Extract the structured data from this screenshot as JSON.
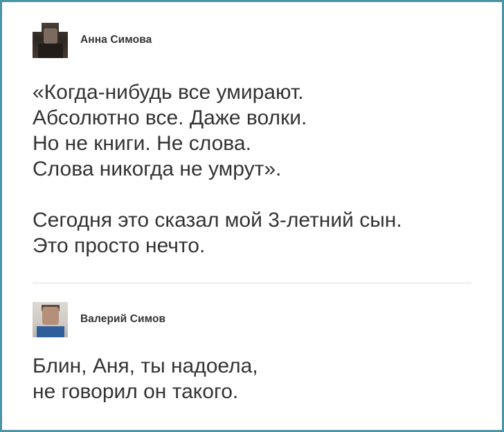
{
  "posts": [
    {
      "author": "Анна Симова",
      "avatar_icon": "user-avatar-icon",
      "paragraphs": [
        [
          "«Когда-нибудь все умирают.",
          "Абсолютно все. Даже волки.",
          "Но не книги. Не слова.",
          "Слова никогда не умрут»."
        ],
        [
          "Сегодня это сказал мой 3-летний сын.",
          "Это просто нечто."
        ]
      ]
    },
    {
      "author": "Валерий Симов",
      "avatar_icon": "user-avatar-icon",
      "paragraphs": [
        [
          "Блин, Аня, ты надоела,",
          "не говорил он такого."
        ]
      ]
    }
  ],
  "colors": {
    "frame_border": "#4a93a6",
    "text": "#333333",
    "divider": "#d8d8d8",
    "background": "#ffffff"
  }
}
